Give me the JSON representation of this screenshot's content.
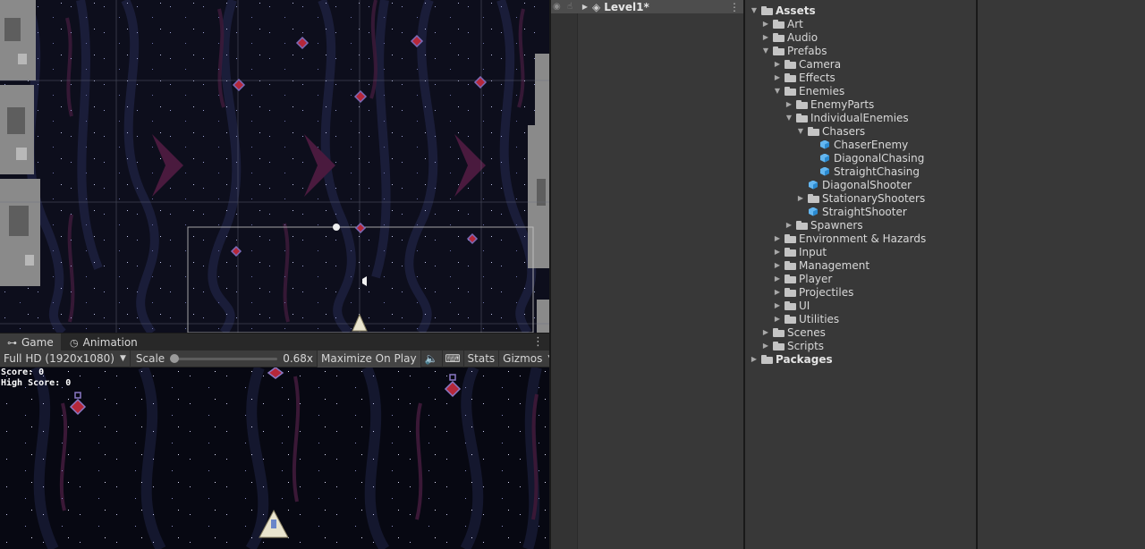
{
  "game_tabs": [
    {
      "label": "Game",
      "icon": "gamepad-icon"
    },
    {
      "label": "Animation",
      "icon": "clock-icon"
    }
  ],
  "game_toolbar": {
    "resolution": "Full HD (1920x1080)",
    "scale_label": "Scale",
    "scale_value": "0.68x",
    "maximize": "Maximize On Play",
    "stats": "Stats",
    "gizmos": "Gizmos"
  },
  "hud": {
    "score": "Score: 0",
    "high_score": "High Score: 0"
  },
  "hierarchy": {
    "scene_name": "Level1*"
  },
  "project_tree": [
    {
      "label": "Assets",
      "depth": 0,
      "arrow": "down",
      "icon": "folder",
      "bold": true
    },
    {
      "label": "Art",
      "depth": 1,
      "arrow": "right",
      "icon": "folder"
    },
    {
      "label": "Audio",
      "depth": 1,
      "arrow": "right",
      "icon": "folder"
    },
    {
      "label": "Prefabs",
      "depth": 1,
      "arrow": "down",
      "icon": "folder"
    },
    {
      "label": "Camera",
      "depth": 2,
      "arrow": "right",
      "icon": "folder"
    },
    {
      "label": "Effects",
      "depth": 2,
      "arrow": "right",
      "icon": "folder"
    },
    {
      "label": "Enemies",
      "depth": 2,
      "arrow": "down",
      "icon": "folder"
    },
    {
      "label": "EnemyParts",
      "depth": 3,
      "arrow": "right",
      "icon": "folder"
    },
    {
      "label": "IndividualEnemies",
      "depth": 3,
      "arrow": "down",
      "icon": "folder"
    },
    {
      "label": "Chasers",
      "depth": 4,
      "arrow": "down",
      "icon": "folder"
    },
    {
      "label": "ChaserEnemy",
      "depth": 5,
      "arrow": "none",
      "icon": "prefab"
    },
    {
      "label": "DiagonalChasing",
      "depth": 5,
      "arrow": "none",
      "icon": "prefab"
    },
    {
      "label": "StraightChasing",
      "depth": 5,
      "arrow": "none",
      "icon": "prefab"
    },
    {
      "label": "DiagonalShooter",
      "depth": 4,
      "arrow": "none",
      "icon": "prefab"
    },
    {
      "label": "StationaryShooters",
      "depth": 4,
      "arrow": "right",
      "icon": "folder"
    },
    {
      "label": "StraightShooter",
      "depth": 4,
      "arrow": "none",
      "icon": "prefab"
    },
    {
      "label": "Spawners",
      "depth": 3,
      "arrow": "right",
      "icon": "folder"
    },
    {
      "label": "Environment & Hazards",
      "depth": 2,
      "arrow": "right",
      "icon": "folder"
    },
    {
      "label": "Input",
      "depth": 2,
      "arrow": "right",
      "icon": "folder"
    },
    {
      "label": "Management",
      "depth": 2,
      "arrow": "right",
      "icon": "folder"
    },
    {
      "label": "Player",
      "depth": 2,
      "arrow": "right",
      "icon": "folder"
    },
    {
      "label": "Projectiles",
      "depth": 2,
      "arrow": "right",
      "icon": "folder"
    },
    {
      "label": "UI",
      "depth": 2,
      "arrow": "right",
      "icon": "folder"
    },
    {
      "label": "Utilities",
      "depth": 2,
      "arrow": "right",
      "icon": "folder"
    },
    {
      "label": "Scenes",
      "depth": 1,
      "arrow": "right",
      "icon": "folder"
    },
    {
      "label": "Scripts",
      "depth": 1,
      "arrow": "right",
      "icon": "folder"
    },
    {
      "label": "Packages",
      "depth": 0,
      "arrow": "right",
      "icon": "folder",
      "bold": true
    }
  ],
  "colors": {
    "panel": "#383838",
    "space": "#0d0e1c",
    "prefab_blue": "#63b6f0"
  }
}
